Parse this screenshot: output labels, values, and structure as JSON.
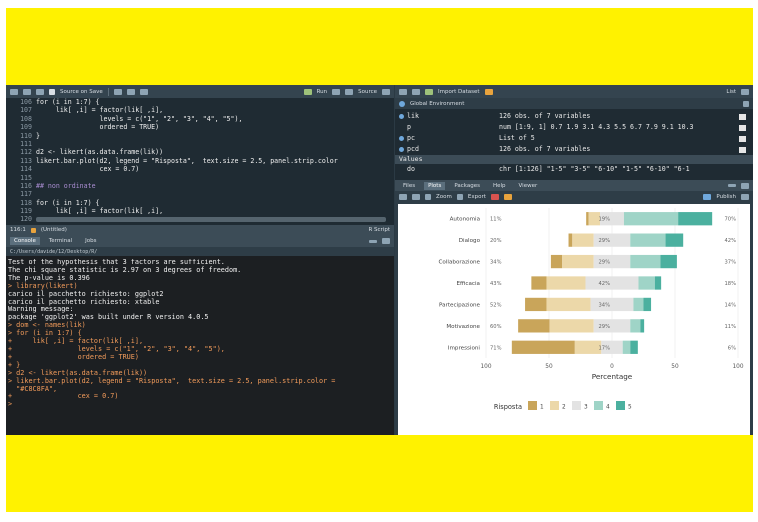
{
  "editor": {
    "toolbar": {
      "source_on_save": "Source on Save",
      "run": "Run",
      "source": "Source"
    },
    "lines": [
      {
        "no": "106",
        "text": "for (i in 1:7) {",
        "kind": "code"
      },
      {
        "no": "107",
        "text": "     lik[ ,i] = factor(lik[ ,i],",
        "kind": "code"
      },
      {
        "no": "108",
        "text": "                levels = c(\"1\", \"2\", \"3\", \"4\", \"5\"),",
        "kind": "code"
      },
      {
        "no": "109",
        "text": "                ordered = TRUE)",
        "kind": "code"
      },
      {
        "no": "110",
        "text": "}",
        "kind": "code"
      },
      {
        "no": "111",
        "text": "",
        "kind": "code"
      },
      {
        "no": "112",
        "text": "d2 <- likert(as.data.frame(lik))",
        "kind": "code"
      },
      {
        "no": "113",
        "text": "likert.bar.plot(d2, legend = \"Risposta\",  text.size = 2.5, panel.strip.color",
        "kind": "code"
      },
      {
        "no": "114",
        "text": "                cex = 0.7)",
        "kind": "code"
      },
      {
        "no": "115",
        "text": "",
        "kind": "code"
      },
      {
        "no": "116",
        "text": "## non ordinate",
        "kind": "comment"
      },
      {
        "no": "117",
        "text": "",
        "kind": "code"
      },
      {
        "no": "118",
        "text": "for (i in 1:7) {",
        "kind": "code"
      },
      {
        "no": "119",
        "text": "     lik[ ,i] = factor(lik[ ,i],",
        "kind": "code"
      },
      {
        "no": "120",
        "text": "",
        "kind": "code"
      }
    ],
    "status": {
      "position": "116:1",
      "scope": "(Untitled)",
      "type": "R Script"
    }
  },
  "console": {
    "tabs": [
      "Console",
      "Terminal",
      "Jobs"
    ],
    "path": "C:/Users/davide/12/Desktop/R/",
    "lines": [
      {
        "text": "Test of the hypothesis that 3 factors are sufficient.",
        "kind": "out"
      },
      {
        "text": "The chi square statistic is 2.97 on 3 degrees of freedom.",
        "kind": "out"
      },
      {
        "text": "The p-value is 0.396",
        "kind": "out"
      },
      {
        "text": "> library(likert)",
        "kind": "cmd"
      },
      {
        "text": "carico il pacchetto richiesto: ggplot2",
        "kind": "out"
      },
      {
        "text": "carico il pacchetto richiesto: xtable",
        "kind": "out"
      },
      {
        "text": "Warning message:",
        "kind": "out"
      },
      {
        "text": "package 'ggplot2' was built under R version 4.0.5",
        "kind": "out"
      },
      {
        "text": "> dom <- names(lik)",
        "kind": "cmd"
      },
      {
        "text": "> for (i in 1:7) {",
        "kind": "cmd"
      },
      {
        "text": "+     lik[ ,i] = factor(lik[ ,i],",
        "kind": "cmd"
      },
      {
        "text": "+                levels = c(\"1\", \"2\", \"3\", \"4\", \"5\"),",
        "kind": "cmd"
      },
      {
        "text": "+                ordered = TRUE)",
        "kind": "cmd"
      },
      {
        "text": "+ }",
        "kind": "cmd"
      },
      {
        "text": "> d2 <- likert(as.data.frame(lik))",
        "kind": "cmd"
      },
      {
        "text": "> likert.bar.plot(d2, legend = \"Risposta\",  text.size = 2.5, panel.strip.color =",
        "kind": "cmd"
      },
      {
        "text": "  \"#C8C8FA\",",
        "kind": "cmd"
      },
      {
        "text": "+                cex = 0.7)",
        "kind": "cmd"
      },
      {
        "text": "> ",
        "kind": "cmd"
      }
    ]
  },
  "environment": {
    "toolbar": {
      "import": "Import Dataset",
      "view": "List"
    },
    "scope": "Global Environment",
    "rows": [
      {
        "name": "lik",
        "value": "126 obs. of 7 variables",
        "dot": true
      },
      {
        "name": "p",
        "value": "num [1:9, 1] 0.7 1.9 3.1 4.3 5.5 6.7 7.9 9.1 10.3",
        "dot": false
      },
      {
        "name": "pc",
        "value": "List of 5",
        "dot": true
      },
      {
        "name": "pcd",
        "value": "126 obs. of 7 variables",
        "dot": true
      }
    ],
    "section": "Values",
    "partial": {
      "name": "do",
      "value": "chr [1:126] \"1-5\" \"3-5\" \"6-10\" \"1-5\" \"6-10\" \"6-1"
    }
  },
  "plots": {
    "tabs": [
      "Files",
      "Plots",
      "Packages",
      "Help",
      "Viewer"
    ],
    "active_tab": "Plots",
    "toolbar": {
      "zoom": "Zoom",
      "export": "Export",
      "publish": "Publish"
    }
  },
  "chart_data": {
    "type": "bar",
    "subtype": "diverging-stacked",
    "categories": [
      "Autonomia",
      "Dialogo",
      "Collaborazione",
      "Efficacia",
      "Partecipazione",
      "Motivazione",
      "Impressioni"
    ],
    "series": [
      {
        "name": "1",
        "color": "#c9a55a",
        "values": [
          2,
          3,
          9,
          12,
          17,
          25,
          50
        ]
      },
      {
        "name": "2",
        "color": "#ecd8a9",
        "values": [
          9,
          17,
          25,
          31,
          35,
          35,
          21
        ]
      },
      {
        "name": "3",
        "color": "#e3e3e3",
        "values": [
          19,
          29,
          29,
          42,
          34,
          29,
          17
        ]
      },
      {
        "name": "4",
        "color": "#9fd4c7",
        "values": [
          43,
          28,
          24,
          13,
          8,
          8,
          6
        ]
      },
      {
        "name": "5",
        "color": "#4bb09f",
        "values": [
          27,
          14,
          13,
          5,
          6,
          3,
          6
        ]
      }
    ],
    "left_labels": [
      "11%",
      "20%",
      "34%",
      "43%",
      "52%",
      "60%",
      "71%"
    ],
    "center_labels": [
      "19%",
      "29%",
      "29%",
      "42%",
      "34%",
      "29%",
      "17%"
    ],
    "right_labels": [
      "70%",
      "42%",
      "37%",
      "18%",
      "14%",
      "11%",
      "6%"
    ],
    "xlabel": "Percentage",
    "xticks": [
      100,
      50,
      0,
      50,
      100
    ],
    "xlim": [
      -100,
      100
    ],
    "legend": {
      "title": "Risposta",
      "position": "bottom"
    },
    "grid": true
  }
}
